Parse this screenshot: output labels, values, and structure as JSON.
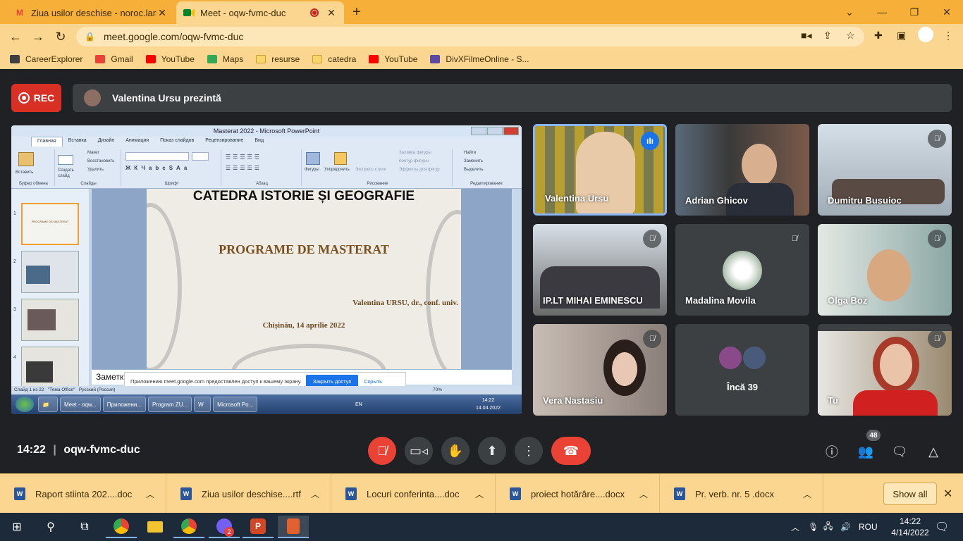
{
  "browser": {
    "tabs": [
      {
        "title": "Ziua usilor deschise - noroc.larisa",
        "icon": "gmail-icon"
      },
      {
        "title": "Meet - oqw-fvmc-duc",
        "icon": "meet-icon"
      }
    ],
    "url": "meet.google.com/oqw-fvmc-duc",
    "bookmarks": [
      {
        "label": "CareerExplorer",
        "color": "#3c4043"
      },
      {
        "label": "Gmail",
        "color": "#ea4335"
      },
      {
        "label": "YouTube",
        "color": "#ff0000"
      },
      {
        "label": "Maps",
        "color": "#34a853"
      },
      {
        "label": "resurse",
        "color": "#f9d66b"
      },
      {
        "label": "catedra",
        "color": "#f9d66b"
      },
      {
        "label": "YouTube",
        "color": "#ff0000"
      },
      {
        "label": "DivXFilmeOnline - S...",
        "color": "#5b4aa0"
      }
    ]
  },
  "meet": {
    "rec_label": "REC",
    "presenting": "Valentina Ursu prezintă",
    "meeting_time": "14:22",
    "meeting_code": "oqw-fvmc-duc",
    "participants_count": "48",
    "tiles": [
      {
        "name": "Valentina Ursu",
        "state": "speaking",
        "bg": "#6d6a3a"
      },
      {
        "name": "Adrian Ghicov",
        "state": "none",
        "bg": "#4e5a6a"
      },
      {
        "name": "Dumitru Busuioc",
        "state": "muted",
        "bg": "#b9c4cc"
      },
      {
        "name": "IP.LT MIHAI EMINESCU",
        "state": "muted",
        "bg": "#6a7a8c"
      },
      {
        "name": "Madalina Movila",
        "state": "muted",
        "bg": "#3c4043"
      },
      {
        "name": "Olga Boz",
        "state": "muted",
        "bg": "#9aa8a8"
      },
      {
        "name": "Vera Nastasiu",
        "state": "muted",
        "bg": "#a59890"
      },
      {
        "name": "Încă 39",
        "state": "none",
        "bg": "#3c4043"
      },
      {
        "name": "Tu",
        "state": "muted",
        "bg": "#c9b8a4"
      }
    ]
  },
  "shared_screen": {
    "window_title": "Masterat 2022 - Microsoft PowerPoint",
    "ribbon_tabs": [
      "Главная",
      "Вставка",
      "Дизайн",
      "Анимация",
      "Показ слайдов",
      "Рецензирование",
      "Вид"
    ],
    "ribbon_groups": [
      "Буфер обмена",
      "Слайды",
      "Шрифт",
      "Абзац",
      "Рисование",
      "Редактирование"
    ],
    "ribbon_buttons": {
      "paste": "Вставить",
      "new_slide": "Создать слайд",
      "layout": "Макет",
      "restore": "Восстановить",
      "delete": "Удалить",
      "shapes": "Фигуры",
      "arrange": "Упорядочить",
      "quick_styles": "Экспресс-стили",
      "fill": "Заливка фигуры",
      "outline": "Контур фигуры",
      "effects": "Эффекты для фигур",
      "find": "Найти",
      "replace": "Заменить",
      "select": "Выделить"
    },
    "slide_header": "CATEDRA ISTORIE ȘI GEOGRAFIE",
    "slide_title": "PROGRAME DE MASTERAT",
    "slide_author": "Valentina URSU, dr., conf. univ.",
    "slide_date": "Chișinău, 14 aprilie 2022",
    "thumb_numbers": [
      "1",
      "2",
      "3",
      "4"
    ],
    "notes_label": "Заметки",
    "share_message": "Приложению meet.google.com предоставлен доступ к вашему экрану.",
    "share_stop": "Закрыть доступ",
    "share_hide": "Скрыть",
    "status_slide": "Слайд 1 из 22",
    "status_theme": "\"Тема Office\"",
    "status_lang": "Русский (Россия)",
    "status_zoom": "70%",
    "taskbar_buttons": [
      "Meet - oqw...",
      "Приложени...",
      "Program ZU...",
      "",
      "Microsoft Po..."
    ],
    "tray_lang": "EN",
    "clock_time": "14:22",
    "clock_date": "14.04.2022"
  },
  "downloads": {
    "items": [
      "Raport stiinta 202....doc",
      "Ziua usilor deschise....rtf",
      "Locuri  conferinta....doc",
      "proiect hotărâre....docx",
      "Pr. verb. nr. 5 .docx"
    ],
    "show_all": "Show all"
  },
  "taskbar": {
    "lang": "ROU",
    "time": "14:22",
    "date": "4/14/2022",
    "viber_badge": "2"
  }
}
